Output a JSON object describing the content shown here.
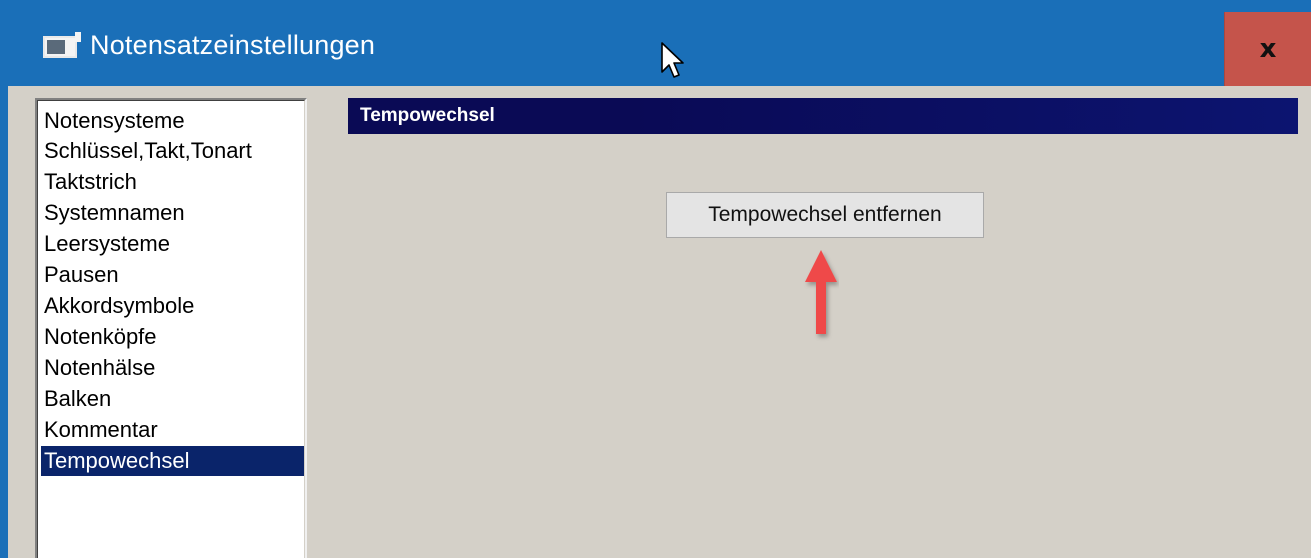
{
  "window": {
    "title": "Notensatzeinstellungen",
    "close_label": "x"
  },
  "sidebar": {
    "items": [
      {
        "label": "Notensysteme",
        "selected": false
      },
      {
        "label": "Schlüssel,Takt,Tonart",
        "selected": false
      },
      {
        "label": "Taktstrich",
        "selected": false
      },
      {
        "label": "Systemnamen",
        "selected": false
      },
      {
        "label": "Leersysteme",
        "selected": false
      },
      {
        "label": "Pausen",
        "selected": false
      },
      {
        "label": "Akkordsymbole",
        "selected": false
      },
      {
        "label": "Notenköpfe",
        "selected": false
      },
      {
        "label": "Notenhälse",
        "selected": false
      },
      {
        "label": "Balken",
        "selected": false
      },
      {
        "label": "Kommentar",
        "selected": false
      },
      {
        "label": "Tempowechsel",
        "selected": true
      }
    ]
  },
  "main": {
    "section_title": "Tempowechsel",
    "remove_button_label": "Tempowechsel entfernen"
  },
  "colors": {
    "titlebar": "#1a6fb8",
    "close_button": "#c5544b",
    "selection": "#0a246a",
    "annotation_arrow": "#ef4a4a"
  }
}
